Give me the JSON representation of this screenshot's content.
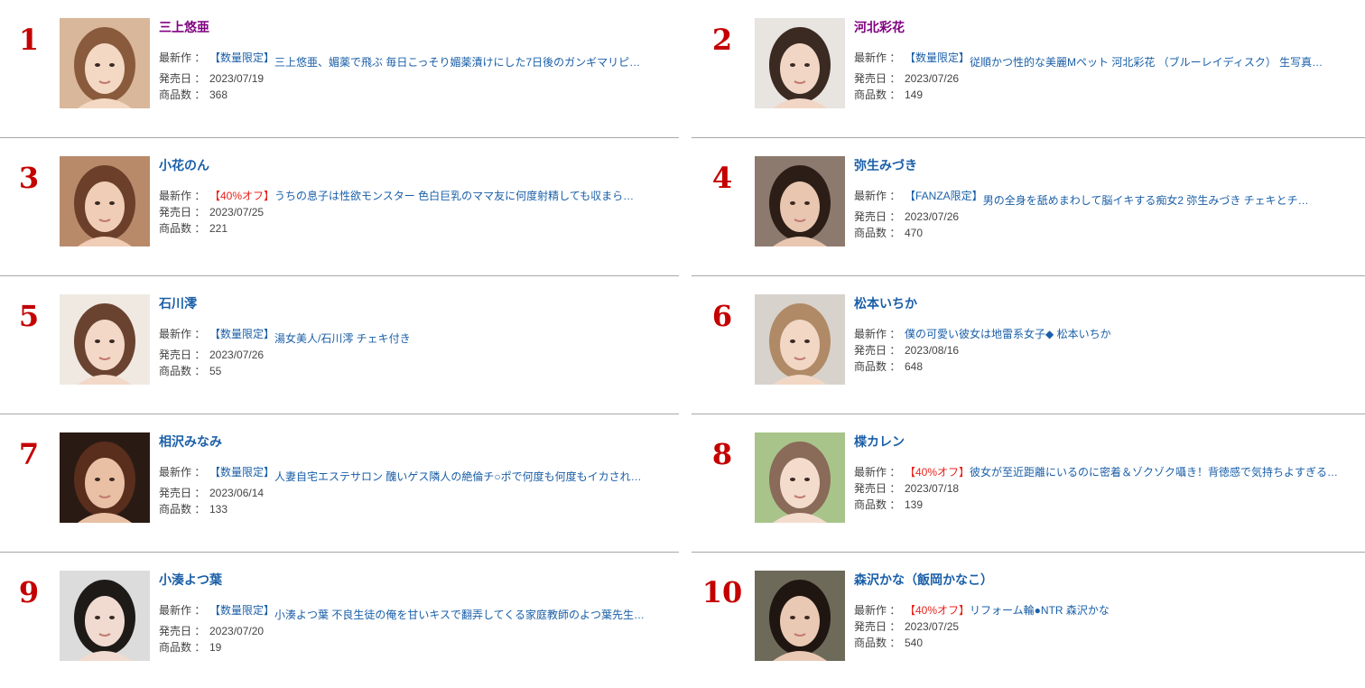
{
  "labels": {
    "latest": "最新作 ：",
    "release": "発売日 ：",
    "count": "商品数 ："
  },
  "colors": {
    "rank": "#c40000",
    "link": "#1a5fa8",
    "visited": "#800080",
    "sale": "#e8231b",
    "divider": "#a8a8a8"
  },
  "actresses": [
    {
      "rank": "1",
      "name": "三上悠亜",
      "tag": "【数量限定】",
      "title": "三上悠亜、媚薬で飛ぶ 毎日こっそり媚薬漬けにした7日後のガンギマリピ…",
      "release": "2023/07/19",
      "count": "368",
      "photo": "actress-photo-1"
    },
    {
      "rank": "2",
      "name": "河北彩花",
      "tag": "【数量限定】",
      "title": "従順かつ性的な美麗Mペット 河北彩花 （ブルーレイディスク） 生写真…",
      "release": "2023/07/26",
      "count": "149",
      "photo": "actress-photo-2"
    },
    {
      "rank": "3",
      "name": "小花のん",
      "tag": "【40%オフ】",
      "title": "うちの息子は性欲モンスター 色白巨乳のママ友に何度射精しても収まら…",
      "release": "2023/07/25",
      "count": "221",
      "photo": "actress-photo-3"
    },
    {
      "rank": "4",
      "name": "弥生みづき",
      "tag": "【FANZA限定】",
      "title": "男の全身を舐めまわして脳イキする痴女2 弥生みづき チェキとチ…",
      "release": "2023/07/26",
      "count": "470",
      "photo": "actress-photo-4"
    },
    {
      "rank": "5",
      "name": "石川澪",
      "tag": "【数量限定】",
      "title": "湯女美人/石川澪 チェキ付き",
      "release": "2023/07/26",
      "count": "55",
      "photo": "actress-photo-5"
    },
    {
      "rank": "6",
      "name": "松本いちか",
      "tag": "",
      "title": "僕の可愛い彼女は地雷系女子◆ 松本いちか",
      "release": "2023/08/16",
      "count": "648",
      "photo": "actress-photo-6"
    },
    {
      "rank": "7",
      "name": "相沢みなみ",
      "tag": "【数量限定】",
      "title": "人妻自宅エステサロン 醜いゲス隣人の絶倫チ○ポで何度も何度もイカされ…",
      "release": "2023/06/14",
      "count": "133",
      "photo": "actress-photo-7"
    },
    {
      "rank": "8",
      "name": "楪カレン",
      "tag": "【40%オフ】",
      "title": "彼女が至近距離にいるのに密着＆ゾクゾク囁き！背徳感で気持ちよすぎる…",
      "release": "2023/07/18",
      "count": "139",
      "photo": "actress-photo-8"
    },
    {
      "rank": "9",
      "name": "小湊よつ葉",
      "tag": "【数量限定】",
      "title": "小湊よつ葉 不良生徒の俺を甘いキスで翻弄してくる家庭教師のよつ葉先生…",
      "release": "2023/07/20",
      "count": "19",
      "photo": "actress-photo-9"
    },
    {
      "rank": "10",
      "name": "森沢かな（飯岡かなこ）",
      "tag": "【40%オフ】",
      "title": "リフォーム輪●NTR 森沢かな",
      "release": "2023/07/25",
      "count": "540",
      "photo": "actress-photo-10"
    }
  ]
}
